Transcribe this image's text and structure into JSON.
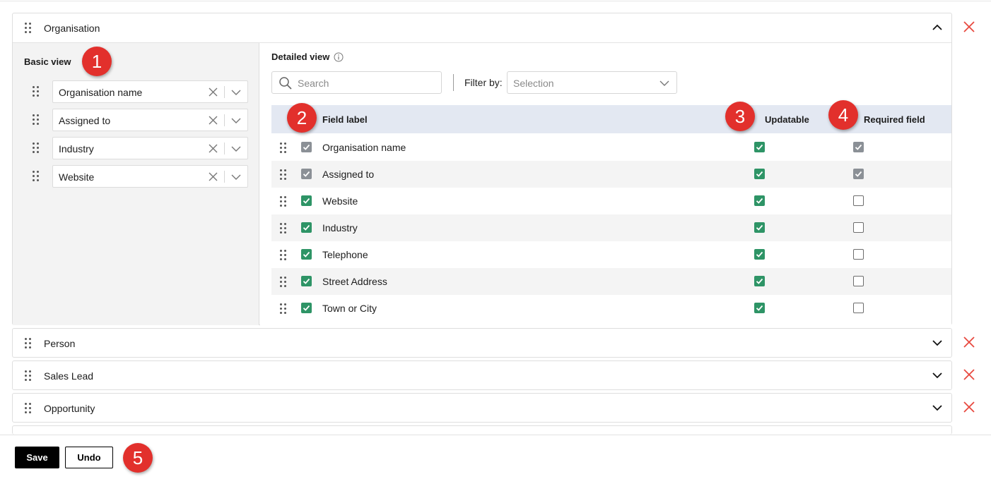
{
  "sections": [
    {
      "title": "Organisation",
      "expanded": true
    },
    {
      "title": "Person",
      "expanded": false
    },
    {
      "title": "Sales Lead",
      "expanded": false
    },
    {
      "title": "Opportunity",
      "expanded": false
    }
  ],
  "basic_view": {
    "title": "Basic view",
    "fields": [
      "Organisation name",
      "Assigned to",
      "Industry",
      "Website"
    ]
  },
  "detailed_view": {
    "title": "Detailed view",
    "search_placeholder": "Search",
    "filter_label": "Filter by:",
    "filter_value": "Selection",
    "columns": {
      "field_label": "Field label",
      "updatable": "Updatable",
      "required": "Required field"
    },
    "rows": [
      {
        "label": "Organisation name",
        "selected": "locked",
        "updatable": true,
        "required": "locked"
      },
      {
        "label": "Assigned to",
        "selected": "locked",
        "updatable": true,
        "required": "locked"
      },
      {
        "label": "Website",
        "selected": "on",
        "updatable": true,
        "required": "off"
      },
      {
        "label": "Industry",
        "selected": "on",
        "updatable": true,
        "required": "off"
      },
      {
        "label": "Telephone",
        "selected": "on",
        "updatable": true,
        "required": "off"
      },
      {
        "label": "Street Address",
        "selected": "on",
        "updatable": true,
        "required": "off"
      },
      {
        "label": "Town or City",
        "selected": "on",
        "updatable": true,
        "required": "off"
      }
    ]
  },
  "badges": [
    "1",
    "2",
    "3",
    "4",
    "5"
  ],
  "actions": {
    "save": "Save",
    "undo": "Undo"
  },
  "colors": {
    "checked": "#2e9466",
    "locked": "#8b9096",
    "badge": "#e2302c",
    "remove": "#e8493f",
    "table_header": "#e3e8f2"
  }
}
